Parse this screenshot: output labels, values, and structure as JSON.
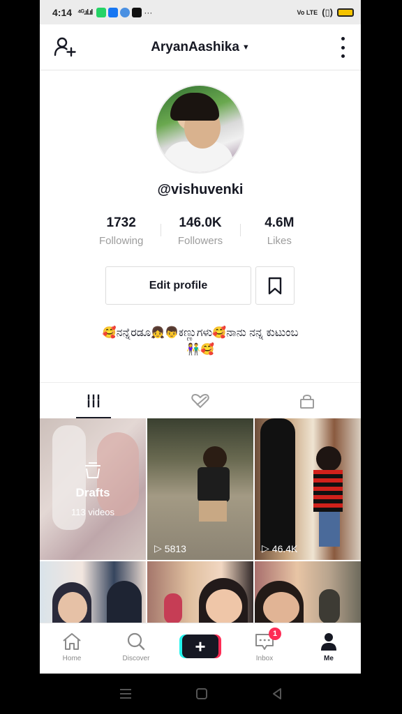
{
  "status_bar": {
    "time": "4:14",
    "signal": "⁴ᴳ.ıl.ıl",
    "volte": "Vo LTE"
  },
  "header": {
    "account_name": "AryanAashika"
  },
  "profile": {
    "username": "@vishuvenki",
    "stats": [
      {
        "value": "1732",
        "label": "Following"
      },
      {
        "value": "146.0K",
        "label": "Followers"
      },
      {
        "value": "4.6M",
        "label": "Likes"
      }
    ],
    "edit_label": "Edit profile",
    "bio_line1": "🥰ನನ್ನೆರಡೂ👧👦ಕಣ್ಣುಗಳು🥰ನಾನು ನನ್ನ ಕುಟುಂಬ",
    "bio_line2": "👫🥰"
  },
  "tabs": [
    "videos-tab",
    "liked-tab",
    "private-tab"
  ],
  "videos": {
    "drafts_label": "Drafts",
    "drafts_count": "113 videos",
    "views": [
      "5813",
      "46.4K"
    ]
  },
  "bottom_nav": {
    "items": [
      {
        "label": "Home",
        "icon": "home-icon"
      },
      {
        "label": "Discover",
        "icon": "search-icon"
      },
      {
        "label": "",
        "icon": "plus-icon"
      },
      {
        "label": "Inbox",
        "icon": "inbox-icon"
      },
      {
        "label": "Me",
        "icon": "profile-icon"
      }
    ],
    "inbox_badge": "1"
  },
  "colors": {
    "accent_red": "#fe2c55",
    "accent_cyan": "#25f4ee",
    "text_primary": "#161823",
    "text_secondary": "#9c9c9c"
  }
}
